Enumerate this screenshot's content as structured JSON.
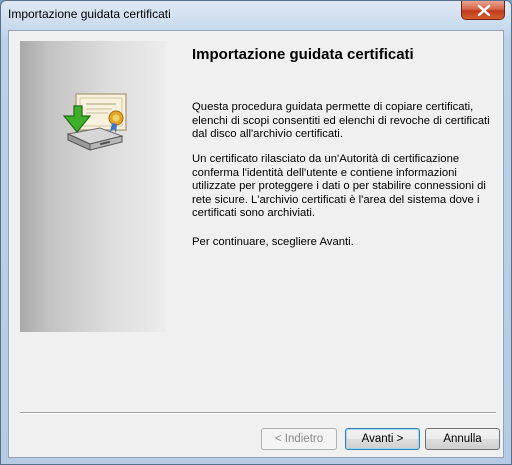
{
  "window": {
    "title": "Importazione guidata certificati",
    "close_icon": "close-icon"
  },
  "wizard": {
    "heading": "Importazione guidata certificati",
    "icon": "certificate-import-icon",
    "paragraphs": [
      "Questa procedura guidata permette di copiare certificati, elenchi di scopi consentiti ed elenchi di revoche di certificati dal disco all'archivio certificati.",
      "Un certificato rilasciato da un'Autorità di certificazione conferma l'identità dell'utente e contiene informazioni utilizzate per proteggere i dati o per stabilire connessioni di rete sicure. L'archivio certificati è l'area del sistema dove i certificati sono archiviati.",
      "Per continuare, scegliere Avanti."
    ]
  },
  "buttons": {
    "back": "< Indietro",
    "next": "Avanti >",
    "cancel": "Annulla"
  },
  "colors": {
    "close_button": "#c74b2c",
    "default_button_border": "#3c7fb1",
    "disabled_text": "#8b8b8b"
  }
}
